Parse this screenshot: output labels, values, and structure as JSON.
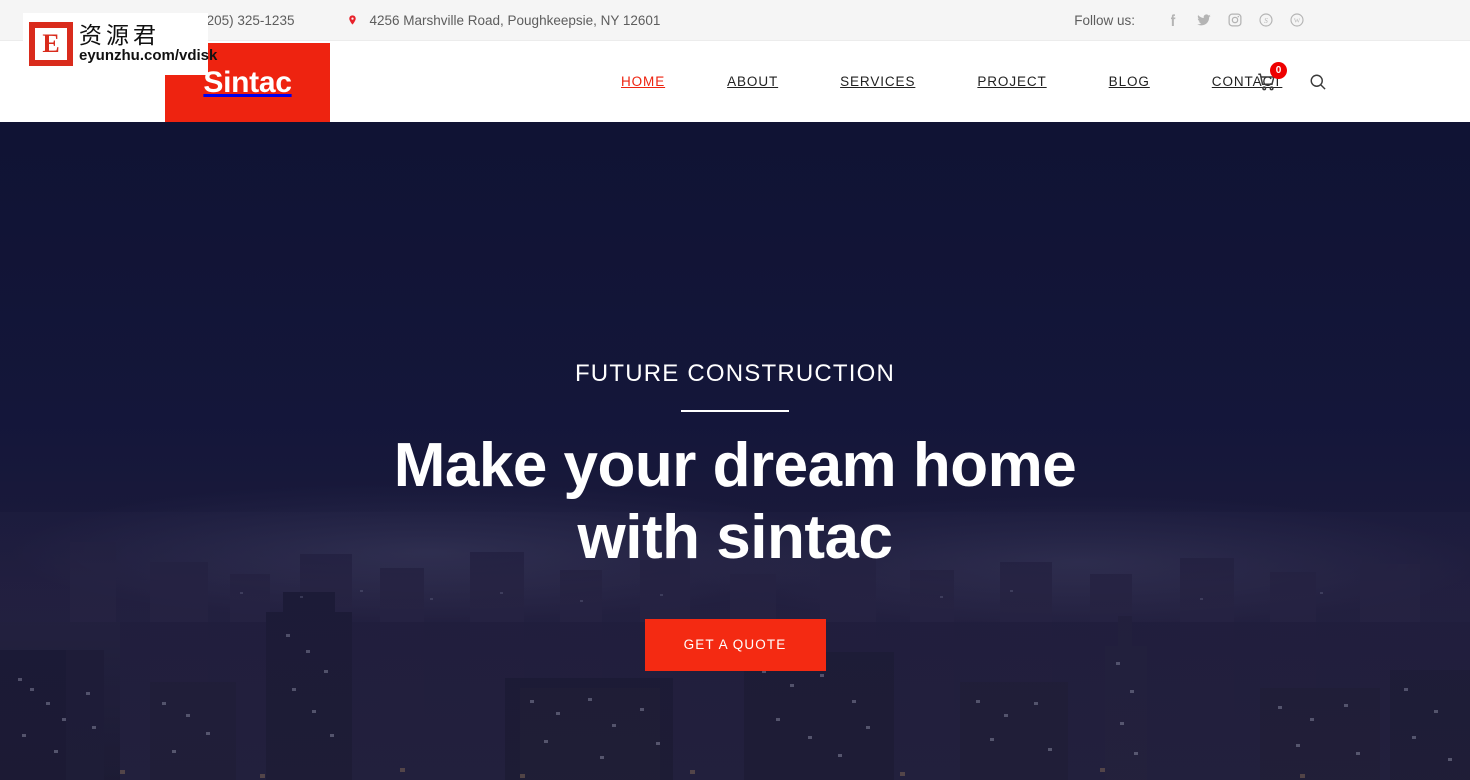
{
  "topbar": {
    "phone": "+1 (205) 325-1235",
    "phone_icon": "phone-icon",
    "address": "4256 Marshville Road, Poughkeepsie, NY 12601",
    "address_icon": "map-pin-icon",
    "follow_label": "Follow us:",
    "socials": [
      {
        "name": "facebook-icon",
        "label": "Facebook"
      },
      {
        "name": "twitter-icon",
        "label": "Twitter"
      },
      {
        "name": "instagram-icon",
        "label": "Instagram"
      },
      {
        "name": "skype-icon",
        "label": "Skype"
      },
      {
        "name": "wordpress-icon",
        "label": "WordPress"
      }
    ]
  },
  "navbar": {
    "logo": "Sintac",
    "menu": [
      {
        "label": "HOME",
        "active": true
      },
      {
        "label": "ABOUT",
        "active": false
      },
      {
        "label": "SERVICES",
        "active": false
      },
      {
        "label": "PROJECT",
        "active": false
      },
      {
        "label": "BLOG",
        "active": false
      },
      {
        "label": "CONTACT",
        "active": false
      }
    ],
    "cart_count": "0",
    "cart_icon": "shopping-cart-icon",
    "search_icon": "search-icon"
  },
  "hero": {
    "subtitle": "FUTURE CONSTRUCTION",
    "title_line1": "Make your dream home",
    "title_line2": "with sintac",
    "cta_label": "GET A QUOTE"
  },
  "watermark": {
    "letter": "E",
    "chinese": "资源君",
    "url": "eyunzhu.com/vdisk"
  },
  "colors": {
    "brand_red": "#ee2310",
    "cta_red": "#f42a12",
    "topbar_bg": "#f5f5f5",
    "hero_navy": "#141637",
    "badge_red": "#ee0000"
  }
}
